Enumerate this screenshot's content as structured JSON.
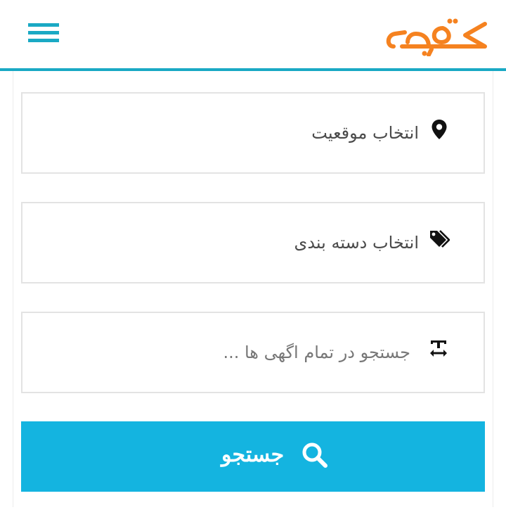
{
  "header": {
    "logo_text": "کرمک",
    "menu_icon": "hamburger-menu-icon"
  },
  "form": {
    "location": {
      "label": "انتخاب موقعیت",
      "icon": "map-marker-icon"
    },
    "category": {
      "label": "انتخاب دسته بندی",
      "icon": "tags-icon"
    },
    "search": {
      "placeholder": "جستجو در تمام اگهی ها ...",
      "icon": "text-width-icon"
    },
    "submit": {
      "label": "جستجو",
      "icon": "search-icon"
    }
  },
  "colors": {
    "accent": "#1aa9c4",
    "button": "#14b4e0",
    "logo": "#f58220"
  }
}
